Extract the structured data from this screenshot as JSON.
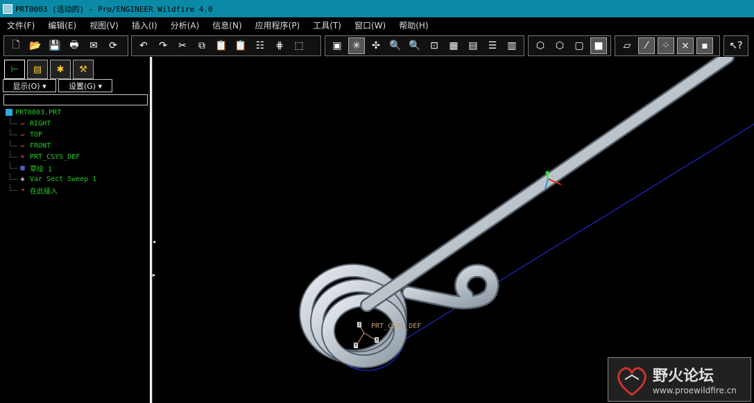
{
  "window": {
    "title": "PRT0003 (活动的) - Pro/ENGINEER Wildfire 4.0"
  },
  "menu": [
    "文件(F)",
    "编辑(E)",
    "视图(V)",
    "插入(I)",
    "分析(A)",
    "信息(N)",
    "应用程序(P)",
    "工具(T)",
    "窗口(W)",
    "帮助(H)"
  ],
  "left_panel": {
    "show_dropdown": "显示(O) ▾",
    "settings_dropdown": "设置(G) ▾",
    "tree": {
      "root": "PRT0003.PRT",
      "items": [
        "RIGHT",
        "TOP",
        "FRONT",
        "PRT_CSYS_DEF",
        "草绘 1",
        "Var Sect Sweep 1",
        "在此插入"
      ]
    }
  },
  "viewport": {
    "csys_label": "PRT_CSYS_DEF",
    "axis_x": "X",
    "axis_y": "Y",
    "axis_z": "Z"
  },
  "watermark": {
    "name": "野火论坛",
    "url": "www.proewildfire.cn"
  }
}
